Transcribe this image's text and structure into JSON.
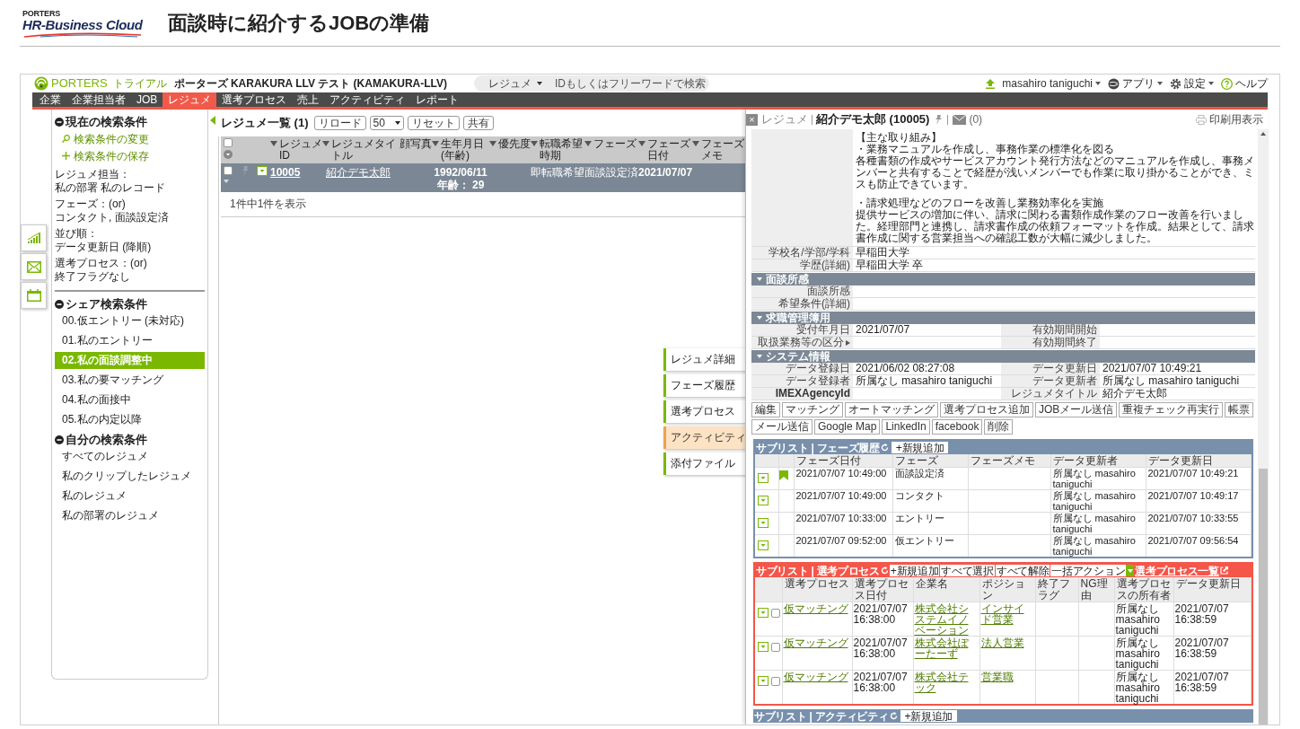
{
  "page": {
    "logo_brand": "PORTERS",
    "logo_product": "HR-Business Cloud",
    "title": "面談時に紹介するJOBの準備"
  },
  "topbar": {
    "brand": "PORTERS",
    "plan": "トライアル",
    "tenant": "ポーターズ KARAKURA LLV テスト (KAMAKURA-LLV)",
    "search_scope": "レジュメ",
    "placeholder": "IDもしくはフリーワードで検索",
    "user": "masahiro taniguchi",
    "menus": [
      {
        "kind": "apps",
        "label": "アプリ",
        "dropdown": true
      },
      {
        "kind": "settings",
        "label": "設定",
        "dropdown": true
      },
      {
        "kind": "help",
        "label": "ヘルプ",
        "dropdown": false
      }
    ]
  },
  "nav": [
    {
      "label": "企業",
      "selected": false
    },
    {
      "label": "企業担当者",
      "selected": false
    },
    {
      "label": "JOB",
      "selected": false
    },
    {
      "label": "レジュメ",
      "selected": true
    },
    {
      "label": "選考プロセス",
      "selected": false
    },
    {
      "label": "売上",
      "selected": false
    },
    {
      "label": "アクティビティ",
      "selected": false
    },
    {
      "label": "レポート",
      "selected": false
    }
  ],
  "sidebar": {
    "current": {
      "title": "現在の検索条件",
      "actions": [
        {
          "kind": "change",
          "label": "検索条件の変更"
        },
        {
          "kind": "save",
          "label": "検索条件の保存"
        }
      ],
      "conditions": [
        {
          "label": "レジュメ担当：",
          "value": "私の部署 私のレコード"
        },
        {
          "label": "フェーズ：(or)",
          "value": "コンタクト, 面談設定済"
        },
        {
          "label": "並び順：",
          "value": "データ更新日 (降順)"
        },
        {
          "label": "選考プロセス：(or)",
          "value": "終了フラグなし"
        }
      ]
    },
    "shared": {
      "title": "シェア検索条件",
      "items": [
        {
          "label": "00.仮エントリー (未対応)",
          "selected": false
        },
        {
          "label": "01.私のエントリー",
          "selected": false
        },
        {
          "label": "02.私の面談調整中",
          "selected": true
        },
        {
          "label": "03.私の要マッチング",
          "selected": false
        },
        {
          "label": "04.私の面接中",
          "selected": false
        },
        {
          "label": "05.私の内定以降",
          "selected": false
        }
      ]
    },
    "mine": {
      "title": "自分の検索条件",
      "items": [
        {
          "label": "すべてのレジュメ",
          "selected": false
        },
        {
          "label": "私のクリップしたレジュメ",
          "selected": false
        },
        {
          "label": "私のレジュメ",
          "selected": false
        },
        {
          "label": "私の部署のレジュメ",
          "selected": false
        }
      ]
    }
  },
  "list": {
    "title": "レジュメ一覧 (1)",
    "toolbar": [
      {
        "kind": "button",
        "label": "リロード"
      },
      {
        "kind": "select",
        "label": "50"
      },
      {
        "kind": "button",
        "label": "リセット"
      },
      {
        "kind": "button",
        "label": "共有"
      }
    ],
    "all_checked": false,
    "columns": [
      {
        "label": "レジュメID",
        "sortable": true
      },
      {
        "label": "レジュメタイトル",
        "sortable": true
      },
      {
        "label": "顔写真",
        "sortable": false
      },
      {
        "label": "生年月日(年齢)",
        "sortable": true
      },
      {
        "label": "優先度",
        "sortable": true
      },
      {
        "label": "転職希望時期",
        "sortable": true
      },
      {
        "label": "フェーズ",
        "sortable": true
      },
      {
        "label": "フェーズ日付",
        "sortable": true
      },
      {
        "label": "フェーズメモ",
        "sortable": true
      }
    ],
    "rows": [
      {
        "selected": true,
        "checked": false,
        "pinned": false,
        "id": "10005",
        "title": "紹介デモ太郎",
        "birth": "1992/06/11",
        "age": "年齢： 29",
        "timing": "即転職希望",
        "phase": "面談設定済",
        "phase_date": "2021/07/07"
      }
    ],
    "footer": "1件中1件を表示"
  },
  "detail": {
    "close": "×",
    "type": "レジュメ",
    "name": "紹介デモ太郎 (10005)",
    "pinned": false,
    "mail_count": "(0)",
    "print": "印刷用表示",
    "description": [
      [
        "【主な取り組み】",
        "・業務マニュアルを作成し、事務作業の標準化を図る",
        "各種書類の作成やサービスアカウント発行方法などのマニュアルを作成し、事務メンバーと共有することで経歴が浅いメンバーでも作業に取り掛かることができ、ミスも防止できています。"
      ],
      [
        "・請求処理などのフローを改善し業務効率化を実施",
        "提供サービスの増加に伴い、請求に関わる書類作成作業のフロー改善を行いました。経理部門と連携し、請求書作成の依頼フォーマットを作成。結果として、請求書作成に関する営業担当への確認工数が大幅に減少しました。"
      ]
    ],
    "fields": [
      [
        {
          "label": "学校名/学部/学科",
          "value": "早稲田大学"
        }
      ],
      [
        {
          "label": "学歴(詳細)",
          "value": "早稲田大学 卒"
        }
      ]
    ],
    "sections": [
      {
        "title": "面談所感",
        "rows": [
          [
            {
              "label": "面談所感"
            }
          ],
          [
            {
              "label": "希望条件(詳細)"
            }
          ]
        ]
      },
      {
        "title": "求職管理簿用",
        "rows": [
          [
            {
              "label": "受付年月日",
              "value": "2021/07/07"
            },
            {
              "label": "有効期間開始"
            }
          ],
          [
            {
              "label": "取扱業務等の区分",
              "expandable": true
            },
            {
              "label": "有効期間終了"
            }
          ]
        ]
      },
      {
        "title": "システム情報",
        "rows": [
          [
            {
              "label": "データ登録日",
              "value": "2021/06/02 08:27:08"
            },
            {
              "label": "データ更新日",
              "value": "2021/07/07 10:49:21"
            }
          ],
          [
            {
              "label": "データ登録者",
              "value": "所属なし masahiro taniguchi"
            },
            {
              "label": "データ更新者",
              "value": "所属なし masahiro taniguchi"
            }
          ],
          [
            {
              "label": "IMEXAgencyId",
              "bold": true
            },
            {
              "label": "レジュメタイトル",
              "value": "紹介デモ太郎"
            }
          ]
        ]
      }
    ],
    "actions": [
      "編集",
      "マッチング",
      "オートマッチング",
      "選考プロセス追加",
      "JOBメール送信",
      "重複チェック再実行",
      "帳票",
      "メール送信",
      "Google Map",
      "LinkedIn",
      "facebook",
      "削除"
    ]
  },
  "side_tabs": [
    {
      "label": "レジュメ詳細",
      "selected": false
    },
    {
      "label": "フェーズ履歴",
      "selected": false
    },
    {
      "label": "選考プロセス",
      "selected": false
    },
    {
      "label": "アクティビティ",
      "selected": true
    },
    {
      "label": "添付ファイル",
      "selected": false
    }
  ],
  "phase_sublist": {
    "title": "サブリスト | フェーズ履歴",
    "add": "+新規追加",
    "columns": [
      "フェーズ日付",
      "フェーズ",
      "フェーズメモ",
      "データ更新者",
      "データ更新日"
    ],
    "rows": [
      {
        "flagged": true,
        "date": "2021/07/07 10:49:00",
        "phase": "面談設定済",
        "updater": "所属なし masahiro taniguchi",
        "updated": "2021/07/07 10:49:21"
      },
      {
        "flagged": false,
        "date": "2021/07/07 10:49:00",
        "phase": "コンタクト",
        "updater": "所属なし masahiro taniguchi",
        "updated": "2021/07/07 10:49:17"
      },
      {
        "flagged": false,
        "date": "2021/07/07 10:33:00",
        "phase": "エントリー",
        "updater": "所属なし masahiro taniguchi",
        "updated": "2021/07/07 10:33:55"
      },
      {
        "flagged": false,
        "date": "2021/07/07 09:52:00",
        "phase": "仮エントリー",
        "updater": "所属なし masahiro taniguchi",
        "updated": "2021/07/07 09:56:54"
      }
    ]
  },
  "process_sublist": {
    "title": "サブリスト | 選考プロセス",
    "buttons": [
      "+新規追加",
      "すべて選択",
      "すべて解除"
    ],
    "bulk": "一括アクション",
    "link": "選考プロセス一覧",
    "columns": [
      "選考プロセス",
      "選考プロセス日付",
      "企業名",
      "ポジション",
      "終了フラグ",
      "NG理由",
      "選考プロセスの所有者",
      "データ更新日"
    ],
    "rows": [
      {
        "checked": false,
        "process": "仮マッチング",
        "date": "2021/07/07 16:38:00",
        "company": "株式会社システムイノベーション",
        "position": "インサイド営業",
        "owner": "所属なし masahiro taniguchi",
        "updated": "2021/07/07 16:38:59"
      },
      {
        "checked": false,
        "process": "仮マッチング",
        "date": "2021/07/07 16:38:00",
        "company": "株式会社ぽーたーず",
        "position": "法人営業",
        "owner": "所属なし masahiro taniguchi",
        "updated": "2021/07/07 16:38:59"
      },
      {
        "checked": false,
        "process": "仮マッチング",
        "date": "2021/07/07 16:38:00",
        "company": "株式会社テック",
        "position": "営業職",
        "owner": "所属なし masahiro taniguchi",
        "updated": "2021/07/07 16:38:59"
      }
    ]
  },
  "activity_sublist": {
    "title": "サブリスト | アクティビティ",
    "add": "+新規追加"
  }
}
